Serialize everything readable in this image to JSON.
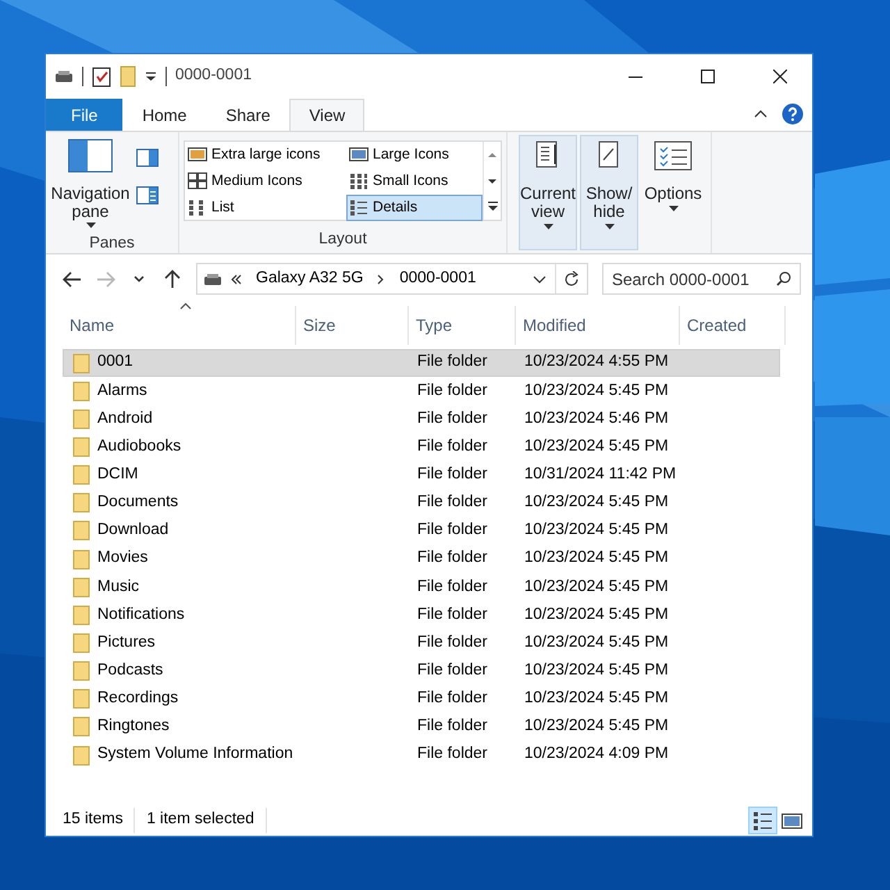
{
  "window": {
    "title": "0000-0001"
  },
  "ribbon_tabs": [
    {
      "label": "File",
      "kind": "file",
      "selected": false
    },
    {
      "label": "Home",
      "kind": "tab",
      "selected": false
    },
    {
      "label": "Share",
      "kind": "tab",
      "selected": false
    },
    {
      "label": "View",
      "kind": "tab",
      "selected": true
    }
  ],
  "ribbon": {
    "panes": {
      "label": "Panes",
      "navigation_pane": "Navigation pane"
    },
    "layout": {
      "label": "Layout",
      "options": [
        {
          "label": "Extra large icons",
          "kind": "xl",
          "selected": false
        },
        {
          "label": "Large Icons",
          "kind": "large",
          "selected": false
        },
        {
          "label": "Medium Icons",
          "kind": "medium",
          "selected": false
        },
        {
          "label": "Small Icons",
          "kind": "small",
          "selected": false
        },
        {
          "label": "List",
          "kind": "list",
          "selected": false
        },
        {
          "label": "Details",
          "kind": "details",
          "selected": true
        }
      ]
    },
    "commands": [
      {
        "label": "Current view",
        "kind": "current",
        "highlighted": true
      },
      {
        "label": "Show/ hide",
        "kind": "showhide",
        "highlighted": true
      },
      {
        "label": "Options",
        "kind": "options",
        "highlighted": false
      }
    ]
  },
  "navigation": [
    {
      "kind": "back",
      "disabled": false
    },
    {
      "kind": "forward",
      "disabled": true
    },
    {
      "kind": "recent",
      "disabled": false
    },
    {
      "kind": "up",
      "disabled": false
    }
  ],
  "address": {
    "segments": [
      "Galaxy A32 5G",
      "0000-0001"
    ]
  },
  "search": {
    "placeholder": "Search 0000-0001"
  },
  "table": {
    "columns": [
      {
        "label": "Name",
        "sorted": true
      },
      {
        "label": "Size",
        "sorted": false
      },
      {
        "label": "Type",
        "sorted": false
      },
      {
        "label": "Modified",
        "sorted": false
      },
      {
        "label": "Created",
        "sorted": false
      }
    ],
    "rows": [
      {
        "name": "0001",
        "type": "File folder",
        "modified": "10/23/2024 4:55 PM",
        "selected": true
      },
      {
        "name": "Alarms",
        "type": "File folder",
        "modified": "10/23/2024 5:45 PM",
        "selected": false
      },
      {
        "name": "Android",
        "type": "File folder",
        "modified": "10/23/2024 5:46 PM",
        "selected": false
      },
      {
        "name": "Audiobooks",
        "type": "File folder",
        "modified": "10/23/2024 5:45 PM",
        "selected": false
      },
      {
        "name": "DCIM",
        "type": "File folder",
        "modified": "10/31/2024 11:42 PM",
        "selected": false
      },
      {
        "name": "Documents",
        "type": "File folder",
        "modified": "10/23/2024 5:45 PM",
        "selected": false
      },
      {
        "name": "Download",
        "type": "File folder",
        "modified": "10/23/2024 5:45 PM",
        "selected": false
      },
      {
        "name": "Movies",
        "type": "File folder",
        "modified": "10/23/2024 5:45 PM",
        "selected": false
      },
      {
        "name": "Music",
        "type": "File folder",
        "modified": "10/23/2024 5:45 PM",
        "selected": false
      },
      {
        "name": "Notifications",
        "type": "File folder",
        "modified": "10/23/2024 5:45 PM",
        "selected": false
      },
      {
        "name": "Pictures",
        "type": "File folder",
        "modified": "10/23/2024 5:45 PM",
        "selected": false
      },
      {
        "name": "Podcasts",
        "type": "File folder",
        "modified": "10/23/2024 5:45 PM",
        "selected": false
      },
      {
        "name": "Recordings",
        "type": "File folder",
        "modified": "10/23/2024 5:45 PM",
        "selected": false
      },
      {
        "name": "Ringtones",
        "type": "File folder",
        "modified": "10/23/2024 5:45 PM",
        "selected": false
      },
      {
        "name": "System Volume Information",
        "type": "File folder",
        "modified": "10/23/2024 4:09 PM",
        "selected": false
      }
    ]
  },
  "status_bar": {
    "item_count": "15 items",
    "selection": "1 item selected",
    "views": [
      {
        "kind": "details",
        "selected": true
      },
      {
        "kind": "large",
        "selected": false
      }
    ]
  }
}
